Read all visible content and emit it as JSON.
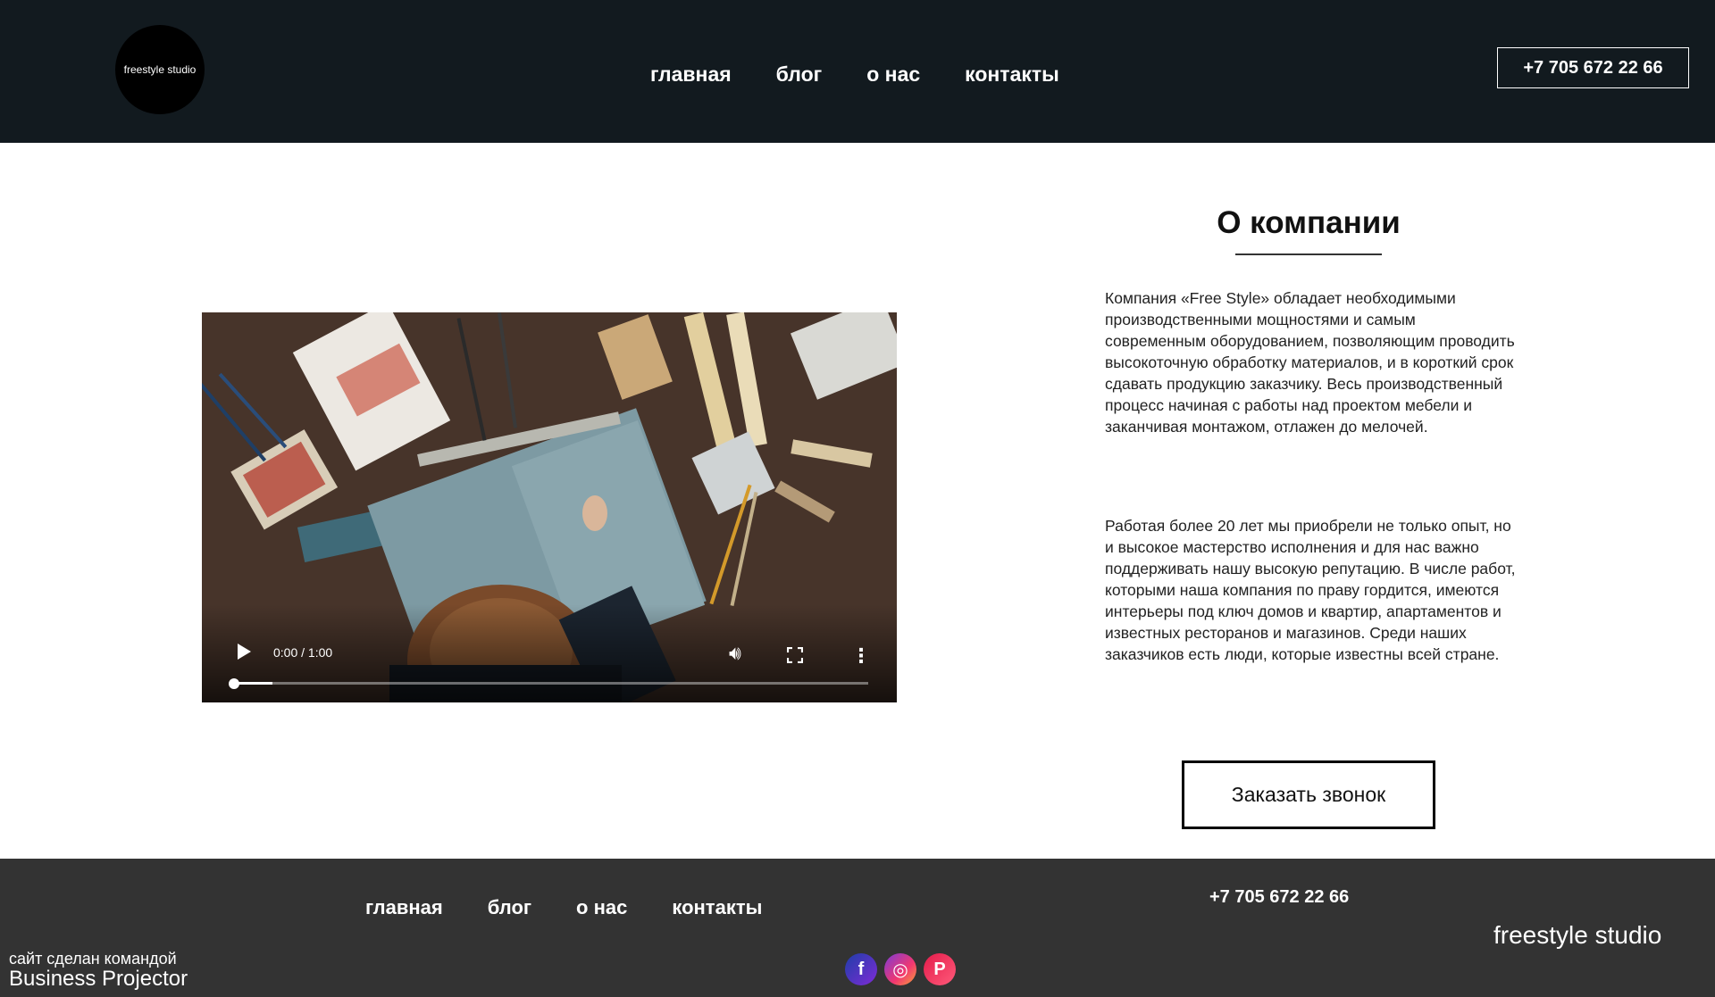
{
  "header": {
    "logo_text": "freestyle studio",
    "nav": [
      "главная",
      "блог",
      "о нас",
      "контакты"
    ],
    "phone": "+7 705 672 22 66"
  },
  "video": {
    "time": "0:00 / 1:00",
    "progress": 0.06
  },
  "about": {
    "title": "О компании",
    "p1": "Компания «Free Style» обладает необходимыми производственными мощностями и самым современным оборудованием, позволяющим проводить высокоточную обработку материалов, и в короткий срок сдавать продукцию заказчику. Весь производственный процесс начиная с работы над проектом мебели и заканчивая монтажом, отлажен до мелочей.",
    "p2": "Работая более 20 лет мы приобрели не только опыт, но и высокое мастерство исполнения и для нас важно поддерживать нашу высокую репутацию. В числе работ, которыми наша компания по праву гордится, имеются интерьеры под ключ домов и квартир, апартаментов и известных ресторанов и магазинов. Среди наших заказчиков есть люди, которые известны всей стране.",
    "call_button": "Заказать звонок"
  },
  "footer": {
    "nav": [
      "главная",
      "блог",
      "о нас",
      "контакты"
    ],
    "phone": "+7 705 672 22 66",
    "brand": "freestyle studio",
    "credit_line1": "сайт сделан командой",
    "credit_line2": "Business Projector",
    "socials": [
      {
        "name": "facebook-icon",
        "glyph": "f"
      },
      {
        "name": "instagram-icon",
        "glyph": "◎"
      },
      {
        "name": "pinterest-icon",
        "glyph": "P"
      }
    ]
  },
  "colors": {
    "header_bg": "#121a1f",
    "footer_bg": "#333333"
  }
}
